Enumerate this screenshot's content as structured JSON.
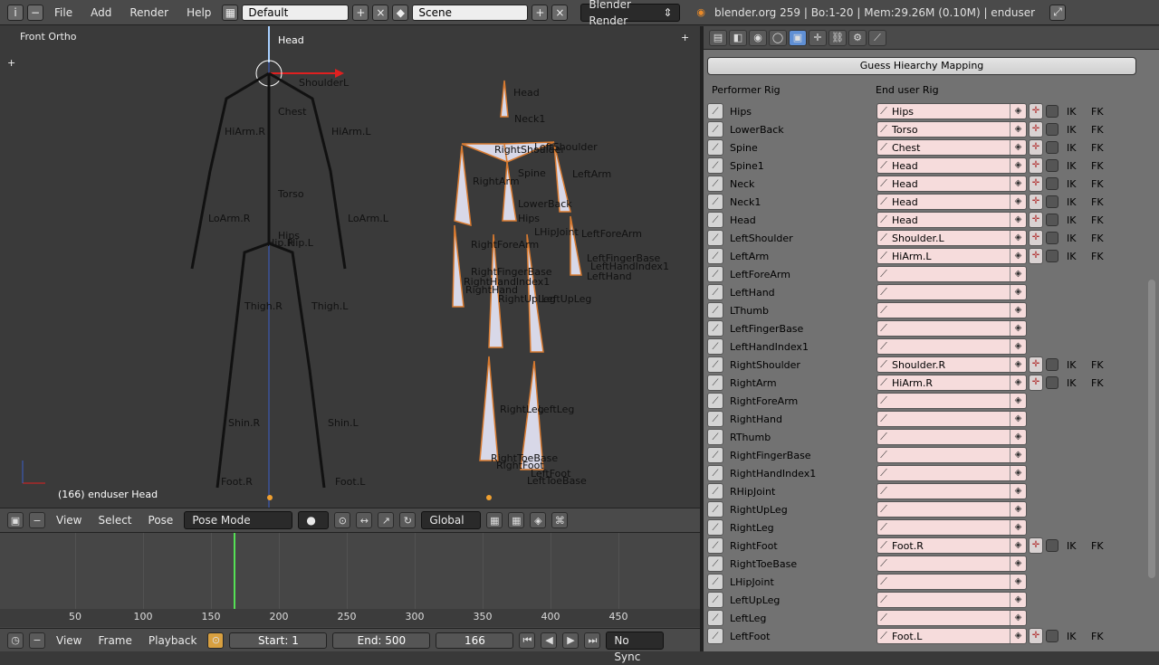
{
  "topbar": {
    "menus": [
      "File",
      "Add",
      "Render",
      "Help"
    ],
    "screen_layout": "Default",
    "scene": "Scene",
    "render_engine": "Blender Render",
    "stats": "blender.org 259 | Bo:1-20 | Mem:29.26M (0.10M) | enduser"
  },
  "viewport": {
    "view_name": "Front Ortho",
    "status": "(166) enduser Head",
    "left_labels": [
      "Head",
      "ShoulderL",
      "Chest",
      "HiArm.R",
      "HiArm.L",
      "Torso",
      "LoArm.R",
      "LoArm.L",
      "Hips",
      "Hip.R",
      "Hip.L",
      "Thigh.R",
      "Thigh.L",
      "Shin.R",
      "Shin.L",
      "Foot.R",
      "Foot.L"
    ],
    "right_labels": [
      "Head",
      "Neck1",
      "RightShoulder",
      "LeftShoulder",
      "Spine",
      "RightArm",
      "LeftArm",
      "LowerBack",
      "Hips",
      "LHipJoint",
      "RightForeArm",
      "LeftForeArm",
      "RightFingerBase",
      "RightHandIndex1",
      "RightHand",
      "LeftFingerBase",
      "LeftHandIndex1",
      "LeftHand",
      "RightUpLeg",
      "LeftUpLeg",
      "RightLeg",
      "LeftLeg",
      "RightToeBase",
      "RightFoot",
      "LeftFoot",
      "LeftToeBase"
    ]
  },
  "viewport_header": {
    "menus": [
      "View",
      "Select",
      "Pose"
    ],
    "mode": "Pose Mode",
    "orientation": "Global"
  },
  "timeline": {
    "ticks": [
      "50",
      "100",
      "150",
      "200",
      "250",
      "300",
      "350",
      "400",
      "450"
    ],
    "menus": [
      "View",
      "Frame",
      "Playback"
    ],
    "start": "Start: 1",
    "end": "End: 500",
    "current": "166",
    "sync": "No Sync"
  },
  "panel": {
    "guess_button": "Guess Hiearchy Mapping",
    "col_performer": "Performer Rig",
    "col_enduser": "End user Rig",
    "ik_label": "IK",
    "fk_label": "FK",
    "rows": [
      {
        "performer": "Hips",
        "enduser": "Hips",
        "ikfk": true
      },
      {
        "performer": "LowerBack",
        "enduser": "Torso",
        "ikfk": true
      },
      {
        "performer": "Spine",
        "enduser": "Chest",
        "ikfk": true
      },
      {
        "performer": "Spine1",
        "enduser": "Head",
        "ikfk": true
      },
      {
        "performer": "Neck",
        "enduser": "Head",
        "ikfk": true
      },
      {
        "performer": "Neck1",
        "enduser": "Head",
        "ikfk": true
      },
      {
        "performer": "Head",
        "enduser": "Head",
        "ikfk": true
      },
      {
        "performer": "LeftShoulder",
        "enduser": "Shoulder.L",
        "ikfk": true
      },
      {
        "performer": "LeftArm",
        "enduser": "HiArm.L",
        "ikfk": true
      },
      {
        "performer": "LeftForeArm",
        "enduser": "",
        "ikfk": false
      },
      {
        "performer": "LeftHand",
        "enduser": "",
        "ikfk": false
      },
      {
        "performer": "LThumb",
        "enduser": "",
        "ikfk": false
      },
      {
        "performer": "LeftFingerBase",
        "enduser": "",
        "ikfk": false
      },
      {
        "performer": "LeftHandIndex1",
        "enduser": "",
        "ikfk": false
      },
      {
        "performer": "RightShoulder",
        "enduser": "Shoulder.R",
        "ikfk": true
      },
      {
        "performer": "RightArm",
        "enduser": "HiArm.R",
        "ikfk": true
      },
      {
        "performer": "RightForeArm",
        "enduser": "",
        "ikfk": false
      },
      {
        "performer": "RightHand",
        "enduser": "",
        "ikfk": false
      },
      {
        "performer": "RThumb",
        "enduser": "",
        "ikfk": false
      },
      {
        "performer": "RightFingerBase",
        "enduser": "",
        "ikfk": false
      },
      {
        "performer": "RightHandIndex1",
        "enduser": "",
        "ikfk": false
      },
      {
        "performer": "RHipJoint",
        "enduser": "",
        "ikfk": false
      },
      {
        "performer": "RightUpLeg",
        "enduser": "",
        "ikfk": false
      },
      {
        "performer": "RightLeg",
        "enduser": "",
        "ikfk": false
      },
      {
        "performer": "RightFoot",
        "enduser": "Foot.R",
        "ikfk": true
      },
      {
        "performer": "RightToeBase",
        "enduser": "",
        "ikfk": false
      },
      {
        "performer": "LHipJoint",
        "enduser": "",
        "ikfk": false
      },
      {
        "performer": "LeftUpLeg",
        "enduser": "",
        "ikfk": false
      },
      {
        "performer": "LeftLeg",
        "enduser": "",
        "ikfk": false
      },
      {
        "performer": "LeftFoot",
        "enduser": "Foot.L",
        "ikfk": true
      }
    ]
  }
}
